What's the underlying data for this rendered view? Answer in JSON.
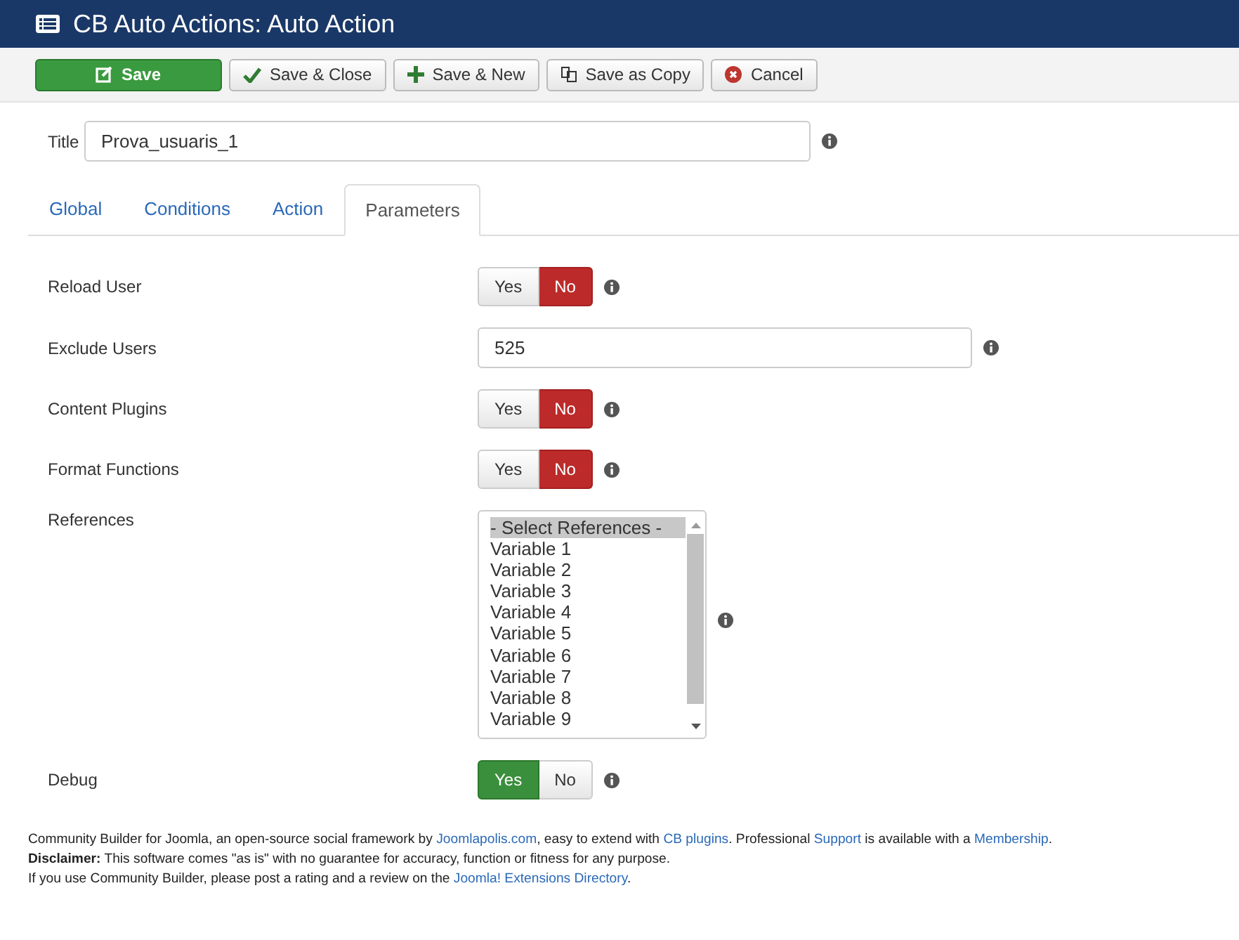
{
  "window": {
    "title": "CB Auto Actions: Auto Action"
  },
  "toolbar": [
    {
      "label": "Save",
      "kind": "primary"
    },
    {
      "label": "Save & Close",
      "kind": "check"
    },
    {
      "label": "Save & New",
      "kind": "plus"
    },
    {
      "label": "Save as Copy",
      "kind": "copy"
    },
    {
      "label": "Cancel",
      "kind": "cancel"
    }
  ],
  "title_field": {
    "label": "Title",
    "value": "Prova_usuaris_1"
  },
  "tabs": [
    {
      "label": "Global",
      "selected": false
    },
    {
      "label": "Conditions",
      "selected": false
    },
    {
      "label": "Action",
      "selected": false
    },
    {
      "label": "Parameters",
      "selected": true
    }
  ],
  "params": [
    {
      "kind": "toggle",
      "label": "Reload User",
      "options": [
        {
          "label": "Yes",
          "selected": false
        },
        {
          "label": "No",
          "selected": true
        }
      ]
    },
    {
      "kind": "input",
      "label": "Exclude Users",
      "value": "525"
    },
    {
      "kind": "toggle",
      "label": "Content Plugins",
      "options": [
        {
          "label": "Yes",
          "selected": false
        },
        {
          "label": "No",
          "selected": true
        }
      ]
    },
    {
      "kind": "toggle",
      "label": "Format Functions",
      "options": [
        {
          "label": "Yes",
          "selected": false
        },
        {
          "label": "No",
          "selected": true
        }
      ]
    },
    {
      "kind": "listbox",
      "label": "References",
      "items": [
        {
          "label": "- Select References -",
          "selected": true
        },
        {
          "label": "Variable 1",
          "selected": false
        },
        {
          "label": "Variable 2",
          "selected": false
        },
        {
          "label": "Variable 3",
          "selected": false
        },
        {
          "label": "Variable 4",
          "selected": false
        },
        {
          "label": "Variable 5",
          "selected": false
        },
        {
          "label": "Variable 6",
          "selected": false
        },
        {
          "label": "Variable 7",
          "selected": false
        },
        {
          "label": "Variable 8",
          "selected": false
        },
        {
          "label": "Variable 9",
          "selected": false
        }
      ]
    },
    {
      "kind": "toggle",
      "label": "Debug",
      "options": [
        {
          "label": "Yes",
          "selected": true
        },
        {
          "label": "No",
          "selected": false
        }
      ]
    }
  ],
  "footer": [
    [
      {
        "text": "Community Builder for Joomla, an open-source social framework by ",
        "link": false
      },
      {
        "text": "Joomlapolis.com",
        "link": true
      },
      {
        "text": ", easy to extend with ",
        "link": false
      },
      {
        "text": "CB plugins",
        "link": true
      },
      {
        "text": ". Professional ",
        "link": false
      },
      {
        "text": "Support",
        "link": true
      },
      {
        "text": " is available with a ",
        "link": false
      },
      {
        "text": "Membership",
        "link": true
      },
      {
        "text": ".",
        "link": false
      }
    ],
    [
      {
        "text": "**Disclaimer:** This software comes \"as is\" with no guarantee for accuracy, function or fitness for any purpose.",
        "link": false
      }
    ],
    [
      {
        "text": "If you use Community Builder, please post a rating and a review on the ",
        "link": false
      },
      {
        "text": "Joomla! Extensions Directory",
        "link": true
      },
      {
        "text": ".",
        "link": false
      }
    ]
  ]
}
